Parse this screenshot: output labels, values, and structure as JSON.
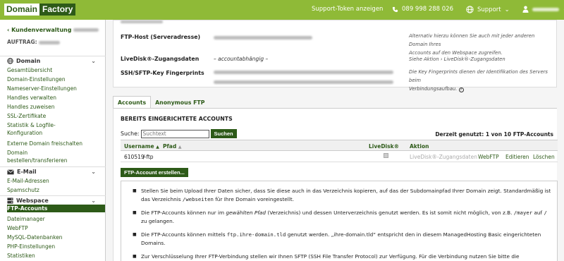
{
  "topbar": {
    "logo_left": "Domain",
    "logo_right": "Factory",
    "support_token": "Support-Token anzeigen",
    "phone": "089 998 288 026",
    "support": "Support",
    "user_icon": "person-icon",
    "phone_icon": "phone-icon",
    "globe_icon": "globe-icon",
    "colors": {
      "bar": "#8fba37",
      "dark": "#2d5a18"
    }
  },
  "sidebar": {
    "back_label": "‹ Kundenverwaltung",
    "auftrag_label": "AUFTRAG:",
    "sections": [
      {
        "title": "Domain",
        "icon": "globe-icon"
      },
      {
        "title": "E-Mail",
        "icon": "envelope-icon"
      },
      {
        "title": "Webspace",
        "icon": "server-icon"
      }
    ],
    "domain_items": [
      "Gesamtübersicht",
      "Domain-Einstellungen",
      "Nameserver-Einstellungen",
      "Handles verwalten",
      "Handles zuweisen",
      "SSL-Zertifikate",
      "Statistik & Logfile-",
      "Konfiguration",
      "Externe Domain freischalten",
      "Domain",
      "bestellen/transferieren"
    ],
    "email_items": [
      "E-Mail-Adressen",
      "Spamschutz"
    ],
    "webspace_items": [
      "FTP-Accounts",
      "Dateimanager",
      "WebFTP",
      "MySQL-Datenbanken",
      "PHP-Einstellungen",
      "Statistiken"
    ]
  },
  "info": {
    "ftp_host_label": "FTP-Host (Serveradresse)",
    "livedisk_label": "LiveDisk®-Zugangsdaten",
    "livedisk_value": "– accountabhängig –",
    "ssh_label": "SSH/SFTP-Key Fingerprints",
    "hint_ftp_line1": "Alternativ hierzu können Sie auch mit jeder anderen Domain Ihres",
    "hint_ftp_line2": "Accounts auf den Webspace zugreifen.",
    "hint_livedisk": "Siehe Aktion › LiveDisk®-Zugangsdaten",
    "hint_ssh_line1": "Die Key Fingerprints dienen der Identifikation des Servers beim",
    "hint_ssh_line2": "Verbindungsaufbau."
  },
  "tabs": [
    {
      "label": "Accounts",
      "active": true
    },
    {
      "label": "Anonymous FTP",
      "active": false
    }
  ],
  "accounts": {
    "title": "BEREITS EINGERICHTETE ACCOUNTS",
    "search_label": "Suche:",
    "search_placeholder": "Suchtext",
    "search_button": "Suchen",
    "usage": "Derzeit genutzt: 1 von 10 FTP-Accounts",
    "columns": [
      "Username",
      "Pfad",
      "LiveDisk®",
      "Aktion"
    ],
    "rows": [
      {
        "username": "610519-ftp",
        "path": "/",
        "actions": [
          "LiveDisk®-Zugangsdaten",
          "WebFTP",
          "Editieren",
          "Löschen"
        ]
      }
    ],
    "create_button": "FTP-Account erstellen..."
  },
  "notes": {
    "n1_a": "Stellen Sie beim Upload Ihrer Daten sicher, dass Sie diese auch in das Verzeichnis kopieren, auf das der Subdomainpfad Ihrer Domain zeigt. Standardmäßig ist das",
    "n1_b": "Verzeichnis",
    "n1_code": "/webseiten",
    "n1_c": "für Ihre Domain voreingestellt.",
    "n2_a": "Die FTP-Accounts können nur im",
    "n2_em": "gewählten Pfad",
    "n2_b": "(Verzeichnis) und dessen Unterverzeichnis genutzt werden. Es ist somit nicht möglich, von z.B.",
    "n2_code1": "/mayer",
    "n2_c": "auf",
    "n2_code2": "/",
    "n2_d": "zu",
    "n2_e": "gelangen.",
    "n3_a": "Die FTP-Accounts können mittels",
    "n3_code": "ftp.ihre-domain.tld",
    "n3_b": "genutzt werden. „ihre-domain.tld“ entspricht den in diesem ManagedHosting Basic eingerichteten",
    "n3_c": "Domains.",
    "n4_a": "Zur Verschlüsselung Ihrer FTP-Verbindung stellen wir Ihnen SFTP (SSH File Transfer Protocol) zur Verfügung. Für die Verbindung nutzen Sie bitte die Zugangsdaten"
  }
}
